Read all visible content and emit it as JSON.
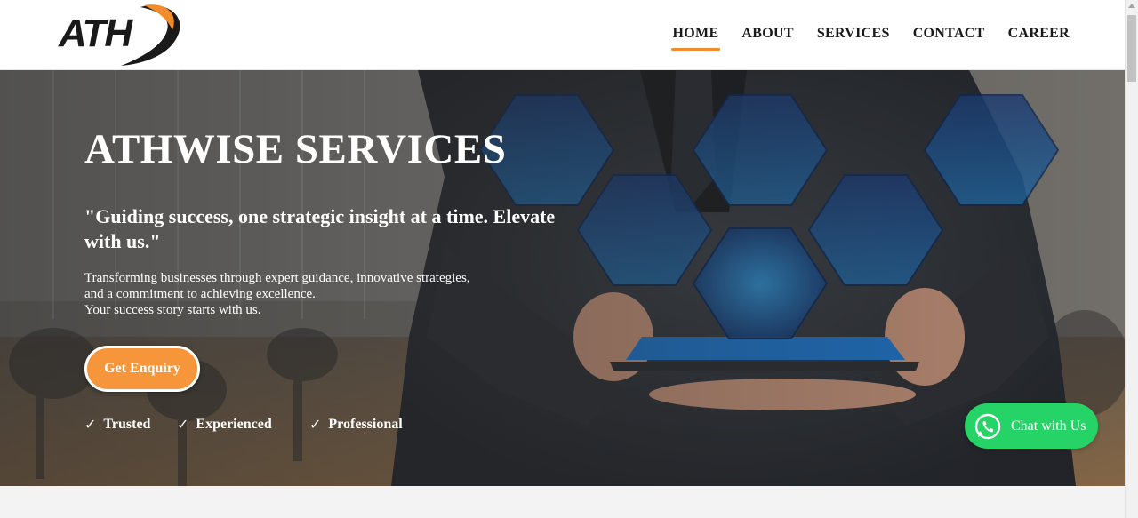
{
  "header": {
    "logo_text": "ATH",
    "nav": [
      {
        "label": "HOME",
        "active": true
      },
      {
        "label": "ABOUT",
        "active": false
      },
      {
        "label": "SERVICES",
        "active": false
      },
      {
        "label": "CONTACT",
        "active": false
      },
      {
        "label": "CAREER",
        "active": false
      }
    ]
  },
  "hero": {
    "title": "ATHWISE SERVICES",
    "quote": "\"Guiding success, one strategic insight at a time. Elevate with us.\"",
    "description": [
      "Transforming businesses through expert guidance, innovative strategies,",
      "and a commitment to achieving excellence.",
      "Your success story starts with us."
    ],
    "cta_label": "Get Enquiry",
    "features": [
      {
        "icon": "check-icon",
        "label": "Trusted"
      },
      {
        "icon": "check-icon",
        "label": "Experienced"
      },
      {
        "icon": "check-icon",
        "label": "Professional"
      }
    ]
  },
  "chat": {
    "icon": "whatsapp-icon",
    "label": "Chat with Us"
  },
  "colors": {
    "accent": "#f7953a",
    "nav_underline": "#f08c2a",
    "chat_green": "#25d366",
    "hex_blue": "#1e5aa8"
  }
}
